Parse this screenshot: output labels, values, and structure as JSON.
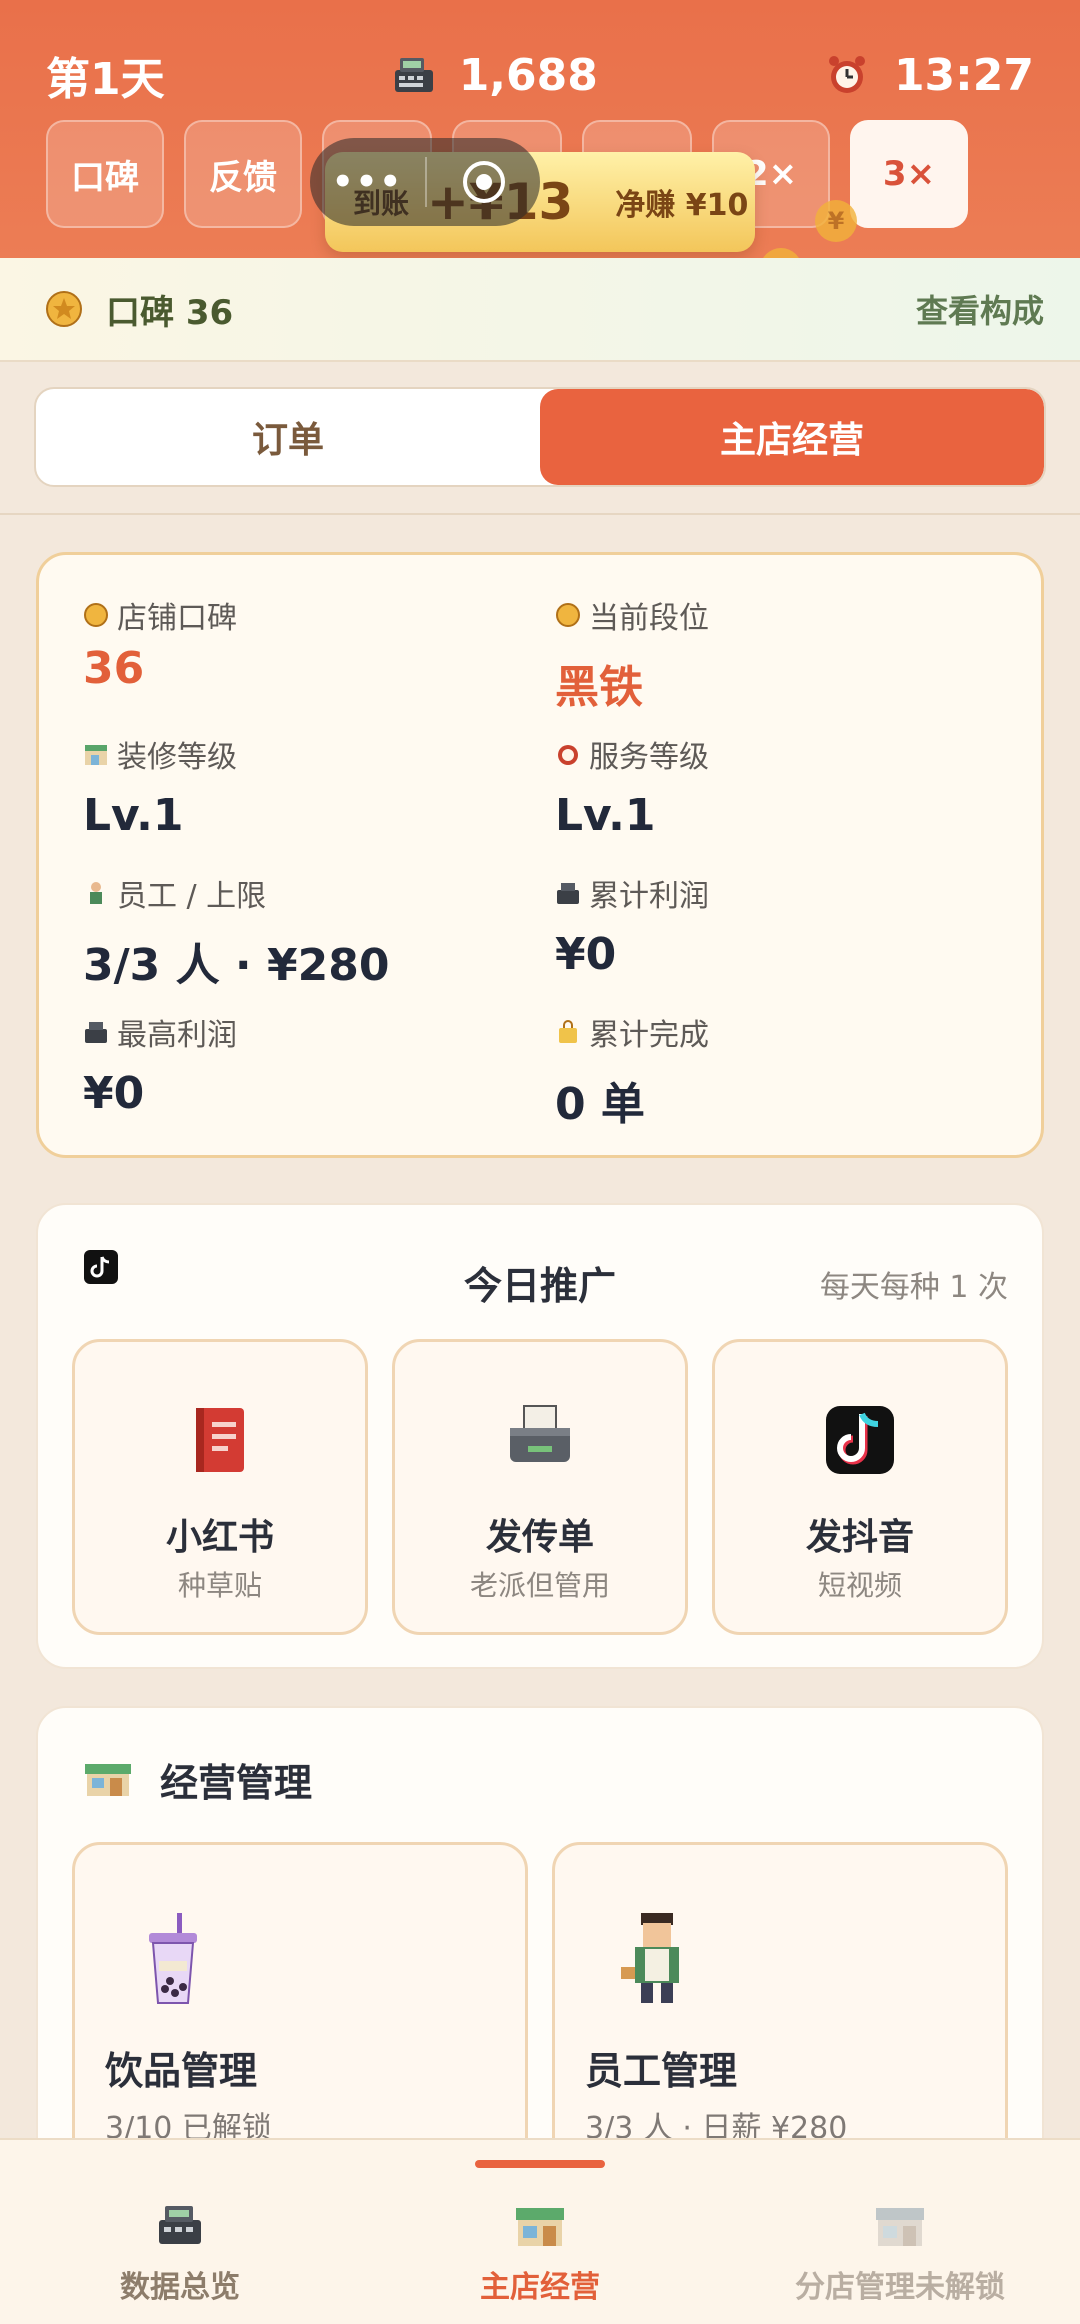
{
  "header": {
    "day": "第1天",
    "money": "1,688",
    "time": "13:27",
    "buttons": [
      "口碑",
      "反馈",
      "2×",
      "3×"
    ]
  },
  "toast": {
    "label": "到账",
    "amount": "+¥13",
    "net": "净赚 ¥10",
    "capsule_dots": "•••"
  },
  "reputation_bar": {
    "label": "口碑 36",
    "link": "查看构成"
  },
  "tabs": [
    "订单",
    "主店经营"
  ],
  "stats": {
    "items": [
      {
        "label": "店铺口碑",
        "value": "36"
      },
      {
        "label": "当前段位",
        "value": "黑铁"
      },
      {
        "label": "装修等级",
        "value": "Lv.1"
      },
      {
        "label": "服务等级",
        "value": "Lv.1"
      },
      {
        "label": "员工 / 上限",
        "value": "3/3 人 · ¥280"
      },
      {
        "label": "累计利润",
        "value": "¥0"
      },
      {
        "label": "最高利润",
        "value": "¥0"
      },
      {
        "label": "累计完成",
        "value": "0 单"
      }
    ]
  },
  "promo": {
    "title": "今日推广",
    "note": "每天每种 1 次",
    "items": [
      {
        "name": "小红书",
        "sub": "种草贴"
      },
      {
        "name": "发传单",
        "sub": "老派但管用"
      },
      {
        "name": "发抖音",
        "sub": "短视频"
      }
    ]
  },
  "manage": {
    "title": "经营管理",
    "items": [
      {
        "name": "饮品管理",
        "sub": "3/10 已解锁"
      },
      {
        "name": "员工管理",
        "sub": "3/3 人 · 日薪 ¥280"
      }
    ]
  },
  "bottom_nav": [
    "数据总览",
    "主店经营",
    "分店管理未解锁"
  ],
  "colors": {
    "accent": "#e9633f",
    "header": "#ea7650",
    "card_border": "#f0cf9a"
  }
}
